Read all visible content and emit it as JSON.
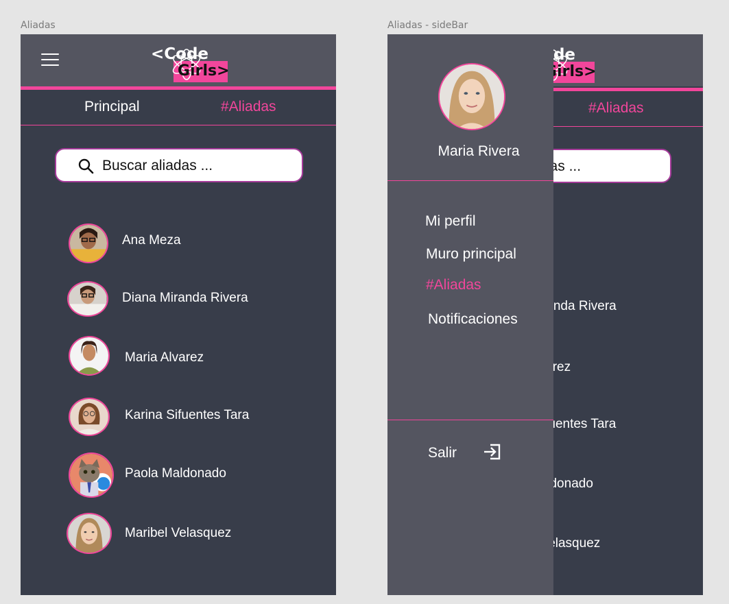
{
  "frames": {
    "left_label": "Aliadas",
    "right_label": "Aliadas - sideBar"
  },
  "logo": {
    "line1": "<Code",
    "line2": "Girls>"
  },
  "tabs": {
    "principal": "Principal",
    "aliadas": "#Aliadas"
  },
  "search": {
    "placeholder": "Buscar aliadas ..."
  },
  "contacts": [
    {
      "name": "Ana Meza"
    },
    {
      "name": "Diana Miranda Rivera"
    },
    {
      "name": "Maria Alvarez"
    },
    {
      "name": "Karina Sifuentes Tara"
    },
    {
      "name": "Paola Maldonado"
    },
    {
      "name": "Maribel Velasquez"
    }
  ],
  "sidebar": {
    "user_name": "Maria Rivera",
    "items": [
      {
        "label": "Mi perfil"
      },
      {
        "label": "Muro principal"
      },
      {
        "label": "#Aliadas"
      },
      {
        "label": "Notificaciones"
      }
    ],
    "logout": "Salir"
  },
  "colors": {
    "accent": "#f2469b",
    "header": "#545560",
    "background": "#383d4a",
    "canvas": "#e5e5e5"
  },
  "icons": [
    "menu-icon",
    "search-icon",
    "logout-icon",
    "atom-icon"
  ]
}
